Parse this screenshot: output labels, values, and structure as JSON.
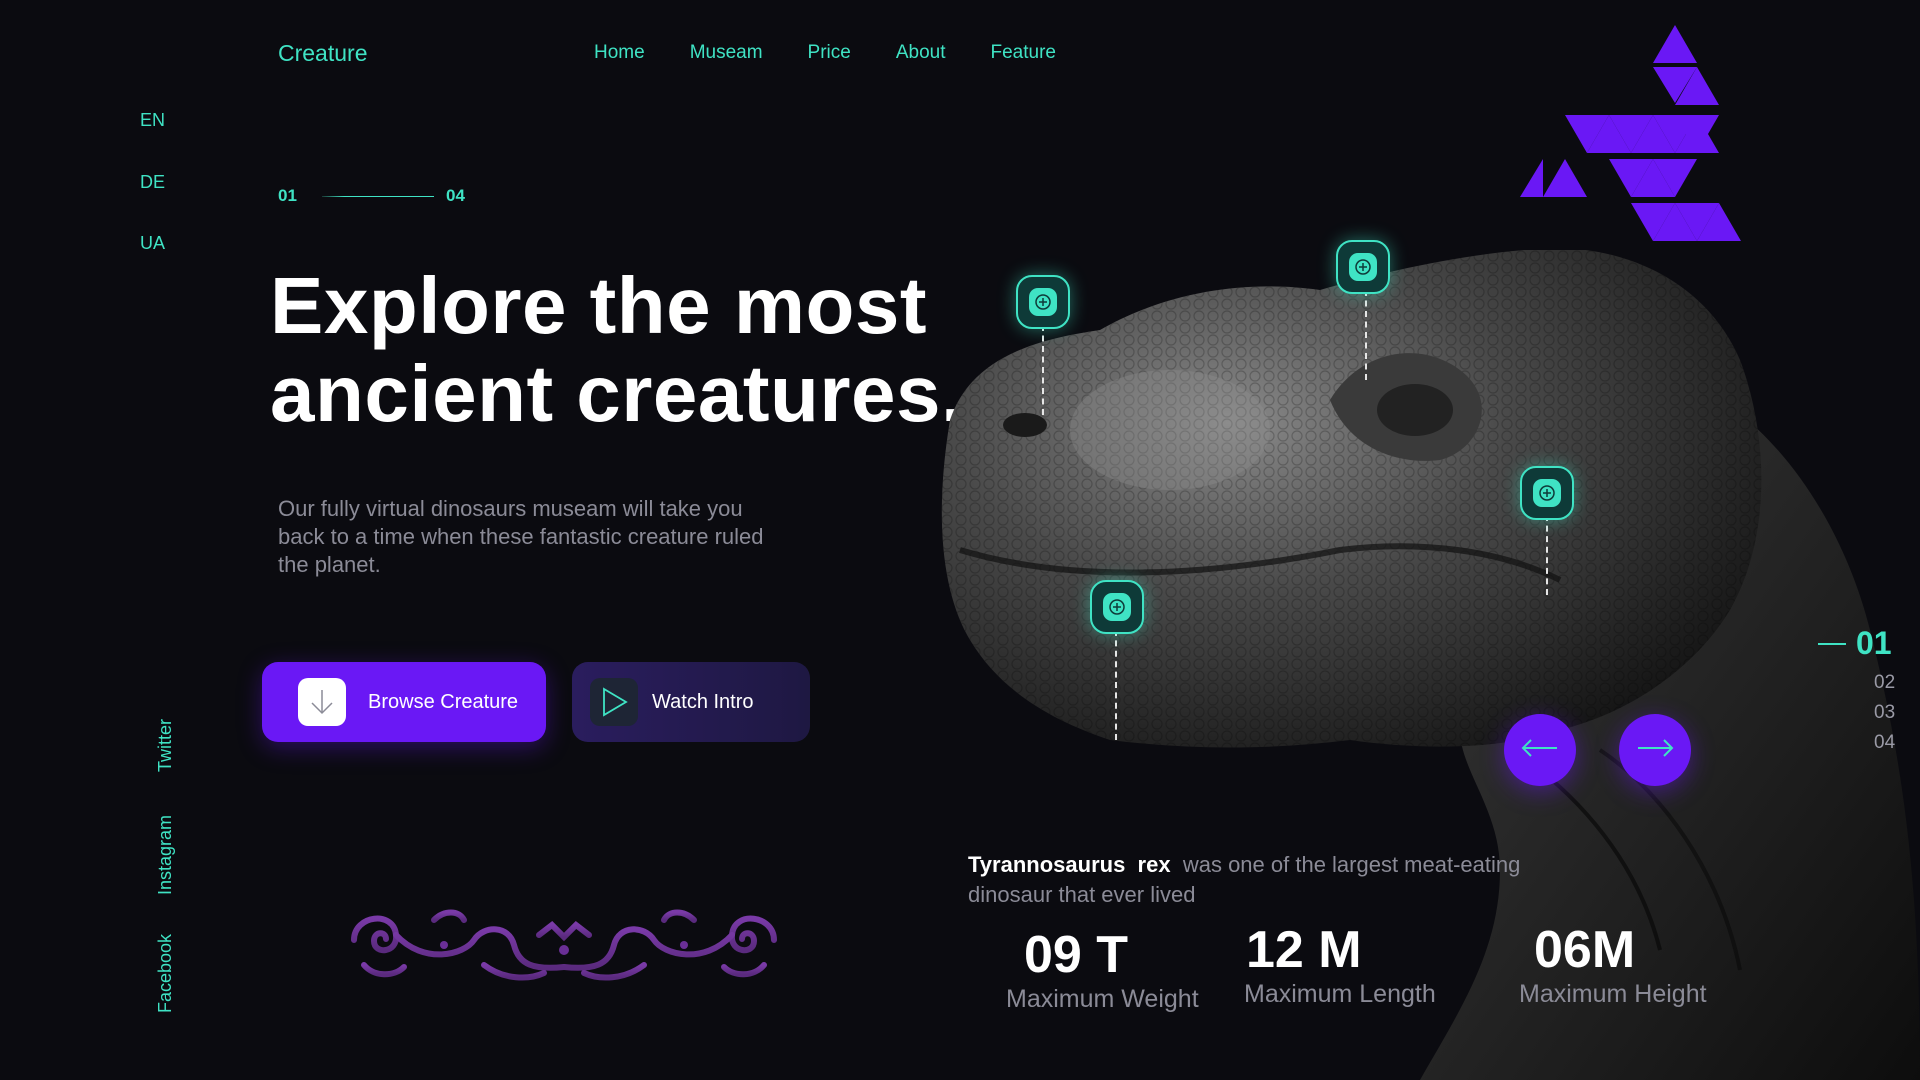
{
  "header": {
    "brand": "Creature",
    "nav": [
      "Home",
      "Museam",
      "Price",
      "About",
      "Feature"
    ]
  },
  "languages": [
    "EN",
    "DE",
    "UA"
  ],
  "social": [
    "Twitter",
    "Instagram",
    "Facebook"
  ],
  "pagination_top": {
    "current": "01",
    "total": "04"
  },
  "hero": {
    "title_line1": "Explore the most",
    "title_line2": "ancient creatures.",
    "subtitle": "Our fully virtual dinosaurs museam will take you back to a time when these fantastic creature ruled the planet."
  },
  "buttons": {
    "browse": "Browse Creature",
    "watch": "Watch Intro"
  },
  "slides": {
    "active": "01",
    "others": [
      "02",
      "03",
      "04"
    ]
  },
  "creature": {
    "name_genus": "Tyrannosaurus",
    "name_species": "rex",
    "description": "was one of the largest meat-eating dinosaur that ever lived"
  },
  "stats": [
    {
      "value": "09 T",
      "label": "Maximum Weight"
    },
    {
      "value": "12 M",
      "label": "Maximum Length"
    },
    {
      "value": "06M",
      "label": "Maximum Height"
    }
  ],
  "icons": {
    "browse": "download-arrow-icon",
    "watch": "play-icon",
    "prev": "arrow-left-icon",
    "next": "arrow-right-icon",
    "hotspot": "plus-circle-icon",
    "logo": "triangle-logo-icon",
    "ornament": "ornament-decoration"
  },
  "colors": {
    "background": "#0b0b10",
    "accent": "#3fe3c4",
    "primary": "#6a18f5",
    "text": "#ffffff",
    "muted": "#8b8b97"
  }
}
